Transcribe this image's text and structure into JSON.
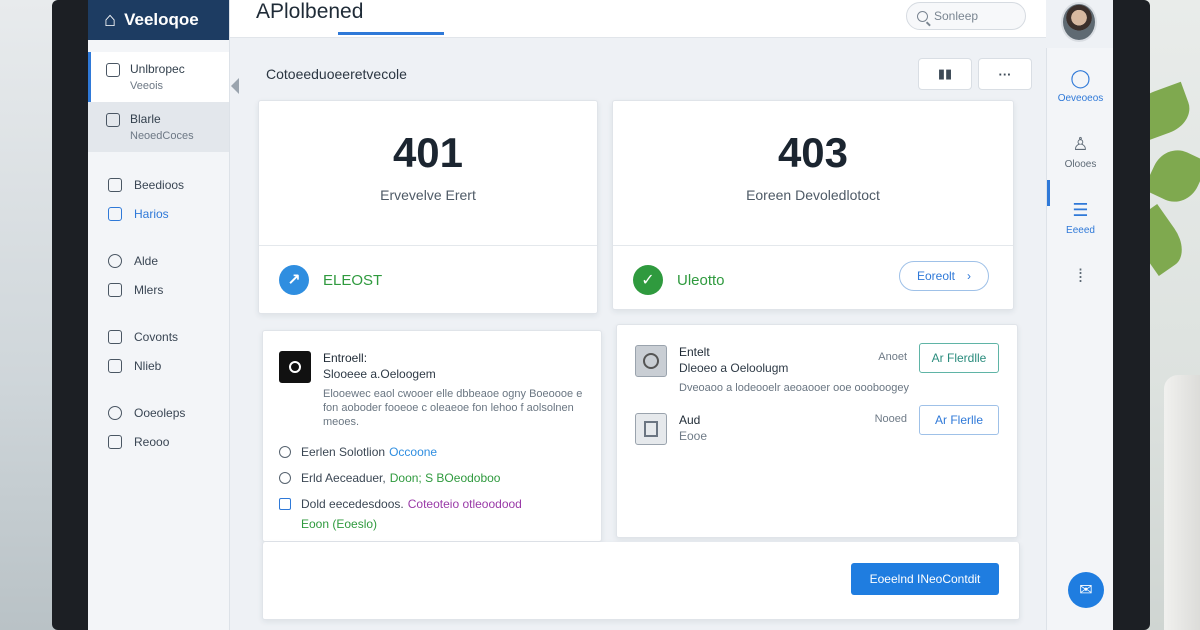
{
  "sidebar": {
    "brand": "Veeloqoe",
    "blocks": [
      {
        "title": "Unlbropec",
        "sub": "Veeois"
      },
      {
        "title": "Blarle",
        "sub": "NeoedCoces"
      }
    ],
    "items": [
      {
        "label": "Beedioos"
      },
      {
        "label": "Harios"
      },
      {
        "label": "Alde"
      },
      {
        "label": "Mlers"
      },
      {
        "label": "Covonts"
      },
      {
        "label": "Nlieb"
      },
      {
        "label": "Ooeoleps"
      },
      {
        "label": "Reooo"
      }
    ]
  },
  "header": {
    "title": "APlolbened",
    "search_placeholder": "Sonleep"
  },
  "main": {
    "section_title": "Cotoeeduoeeretvecole",
    "more_label": "···",
    "cards": [
      {
        "code": "401",
        "subtitle": "Ervevelve Erert",
        "status": "ELEOST",
        "status_color": "#2f8ee0"
      },
      {
        "code": "403",
        "subtitle": "Eoreen Devoledlotoct",
        "status": "Uleotto",
        "status_color": "#2f9a3e",
        "action": "Eoreolt"
      }
    ],
    "left_panel": {
      "title": "Entroell:",
      "subtitle": "Slooeee a.Oeloogem",
      "desc": "Elooewec eaol cwooer elle dbbeaoe ogny Boeoooe e fon aoboder fooeoe c oleaeoe fon lehoo f aolsolnen meoes.",
      "options": [
        {
          "label": "Eerlen Solotlion",
          "tag": "Occoone"
        },
        {
          "label": "Erld Aeceaduer,",
          "tag": "Doon; S BOeodoboo"
        },
        {
          "label": "Dold eecedesdoos.",
          "tag": "Coteoteio otleoodood",
          "note": "Eoon (Eoeslo)"
        }
      ]
    },
    "right_panel": {
      "rows": [
        {
          "title": "Entelt",
          "sub": "Dleoeo a Oeloolugm",
          "meta": "Anoet",
          "button": "Ar Flerdlle"
        },
        {
          "title": "Aud",
          "sub": "Eooe",
          "meta": "Nooed",
          "button": "Ar Flerlle"
        }
      ],
      "desc": "Dveoaoo a lodeooelr aeoaooer ooe oooboogey"
    },
    "primary_action": "Eoeelnd INeoContdit"
  },
  "rail": {
    "items": [
      {
        "label": "Oeveoeos"
      },
      {
        "label": "Olooes"
      },
      {
        "label": "Eeeed"
      }
    ]
  },
  "colors": {
    "brand": "#1d3c62",
    "accent": "#1f7de0",
    "success": "#2f9a3e"
  }
}
